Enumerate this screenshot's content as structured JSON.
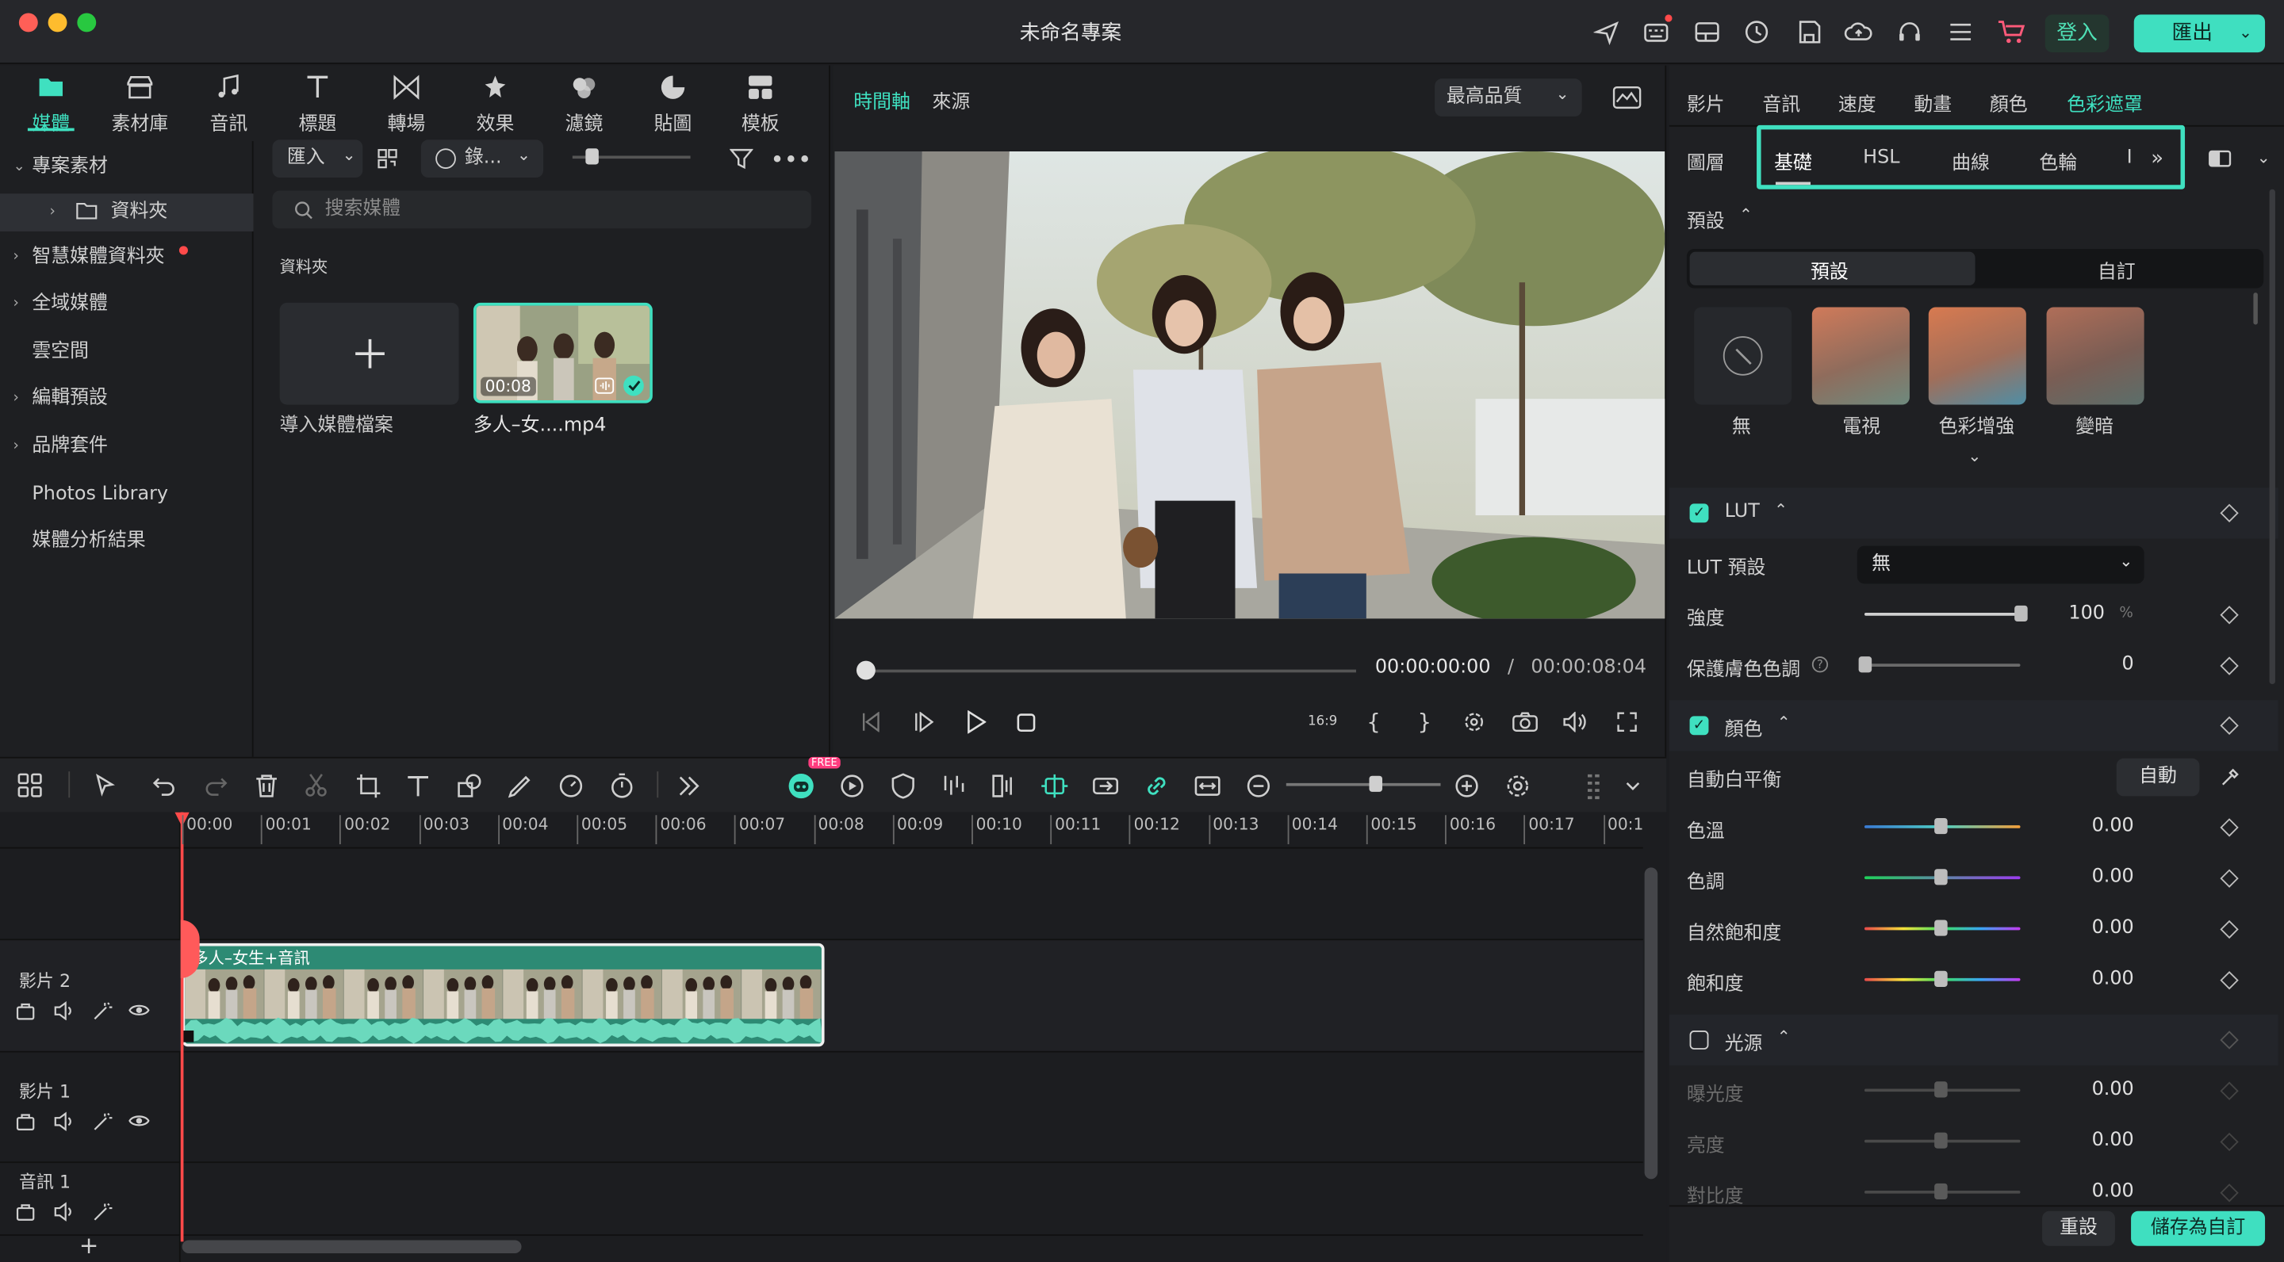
{
  "window": {
    "title": "未命名專案",
    "login_label": "登入",
    "export_label": "匯出"
  },
  "media_tabs": [
    {
      "label": "媒體",
      "icon": "folder-icon"
    },
    {
      "label": "素材庫",
      "icon": "store-icon"
    },
    {
      "label": "音訊",
      "icon": "music-icon"
    },
    {
      "label": "標題",
      "icon": "title-t-icon"
    },
    {
      "label": "轉場",
      "icon": "transition-icon"
    },
    {
      "label": "效果",
      "icon": "effects-icon"
    },
    {
      "label": "濾鏡",
      "icon": "filter-icon"
    },
    {
      "label": "貼圖",
      "icon": "sticker-icon"
    },
    {
      "label": "模板",
      "icon": "template-icon"
    }
  ],
  "tree": [
    {
      "label": "專案素材",
      "arrow": "⌄"
    },
    {
      "label": "資料夾",
      "arrow": "›"
    },
    {
      "label": "智慧媒體資料夾",
      "arrow": "›"
    },
    {
      "label": "全域媒體",
      "arrow": "›"
    },
    {
      "label": "雲空間",
      "arrow": ""
    },
    {
      "label": "編輯預設",
      "arrow": "›"
    },
    {
      "label": "品牌套件",
      "arrow": "›"
    },
    {
      "label": "Photos Library",
      "arrow": ""
    },
    {
      "label": "媒體分析結果",
      "arrow": ""
    }
  ],
  "media": {
    "import_label": "匯入",
    "record_label": "錄...",
    "search_placeholder": "搜索媒體",
    "folder_label": "資料夾",
    "import_card_label": "導入媒體檔案",
    "clip_name": "多人–女....mp4",
    "clip_duration": "00:08"
  },
  "preview": {
    "tab_timeline": "時間軸",
    "tab_source": "來源",
    "quality": "最高品質",
    "timecode": "00:00:00:00",
    "separator": "/",
    "duration": "00:00:08:04"
  },
  "right": {
    "top_tabs": [
      "影片",
      "音訊",
      "速度",
      "動畫",
      "顏色",
      "色彩遮罩"
    ],
    "layer_label": "圖層",
    "sub_tabs": [
      "基礎",
      "HSL",
      "曲線",
      "色輪",
      "I"
    ],
    "preset_section": "預設",
    "preset_toggle": [
      "預設",
      "自訂"
    ],
    "presets": [
      "無",
      "電視",
      "色彩增強",
      "變暗"
    ],
    "lut": {
      "title": "LUT",
      "preset_label": "LUT 預設",
      "preset_value": "無",
      "intensity_label": "強度",
      "intensity_value": "100",
      "intensity_unit": "%",
      "intensity": 1.0,
      "skin_label": "保護膚色色調",
      "skin_value": "0",
      "skin": 0.0
    },
    "color": {
      "title": "顏色",
      "wb_label": "自動白平衡",
      "wb_button": "自動",
      "rows": [
        {
          "label": "色溫",
          "value": "0.00"
        },
        {
          "label": "色調",
          "value": "0.00"
        },
        {
          "label": "自然飽和度",
          "value": "0.00"
        },
        {
          "label": "飽和度",
          "value": "0.00"
        }
      ]
    },
    "light": {
      "title": "光源",
      "rows": [
        {
          "label": "曝光度",
          "value": "0.00"
        },
        {
          "label": "亮度",
          "value": "0.00"
        },
        {
          "label": "對比度",
          "value": "0.00"
        }
      ]
    },
    "reset_label": "重設",
    "save_label": "儲存為自訂"
  },
  "timeline": {
    "ticks": [
      "00:00",
      "00:01",
      "00:02",
      "00:03",
      "00:04",
      "00:05",
      "00:06",
      "00:07",
      "00:08",
      "00:09",
      "00:10",
      "00:11",
      "00:12",
      "00:13",
      "00:14",
      "00:15",
      "00:16",
      "00:17",
      "00:1"
    ],
    "tracks": [
      "影片 2",
      "影片 1",
      "音訊 1"
    ],
    "clip_label": "多人–女生+音訊",
    "free_badge": "FREE"
  }
}
